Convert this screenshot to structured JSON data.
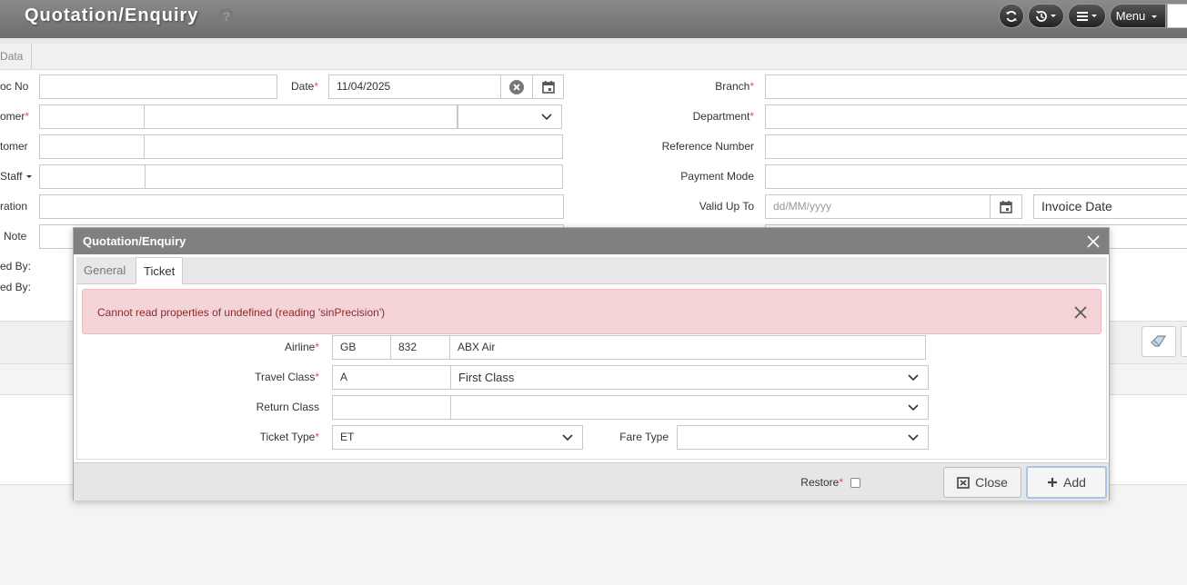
{
  "header": {
    "title": "Quotation/Enquiry",
    "help_symbol": "?",
    "menu_label": "Menu"
  },
  "bg_tabs": {
    "data_tab": "Data"
  },
  "form": {
    "doc_no_label": "oc No",
    "date_label": "Date",
    "date_value": "11/04/2025",
    "branch_label": "Branch",
    "customer_label": "omer",
    "department_label": "Department",
    "customer2_label": "tomer",
    "reference_label": "Reference Number",
    "staff_label": "Staff",
    "payment_label": "Payment Mode",
    "narration_label": "ration",
    "valid_up_to_label": "Valid Up To",
    "valid_up_to_placeholder": "dd/MM/yyyy",
    "invoice_date_value": "Invoice Date",
    "note_label": "Note",
    "created_by_label": "ed By:",
    "modified_by_label": "ed By:"
  },
  "modal": {
    "title": "Quotation/Enquiry",
    "tabs": [
      {
        "label": "General",
        "active": false
      },
      {
        "label": "Ticket",
        "active": true
      }
    ],
    "alert_message": "Cannot read properties of undefined (reading 'sinPrecision')",
    "fields": {
      "airline_label": "Airline",
      "airline_code": "GB",
      "airline_number": "832",
      "airline_name": "ABX Air",
      "travel_class_label": "Travel Class",
      "travel_class_code": "A",
      "travel_class_name": "First Class",
      "return_class_label": "Return Class",
      "ticket_type_label": "Ticket Type",
      "ticket_type_value": "ET",
      "fare_type_label": "Fare Type"
    },
    "footer": {
      "restore_label": "Restore",
      "close_label": "Close",
      "add_label": "Add"
    }
  },
  "required_marker": "*",
  "colors": {
    "required": "#d9534f",
    "header_bg": "#7a7a7a",
    "alert_bg": "#f4d4d6",
    "alert_text": "#8a2a2e"
  }
}
